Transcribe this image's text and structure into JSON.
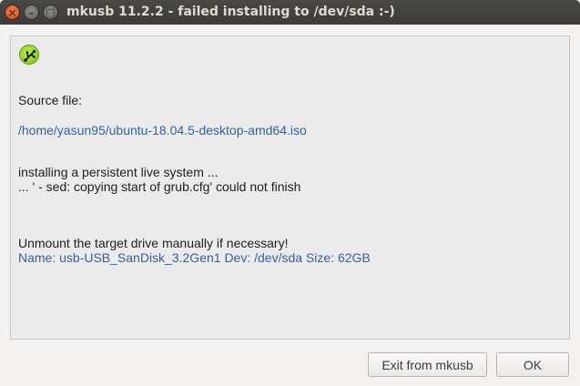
{
  "window": {
    "title": "mkusb 11.2.2 - failed installing to /dev/sda :-)",
    "close_glyph": "×",
    "minimize_glyph": "–",
    "maximize_glyph": "□"
  },
  "app_icon": "usb-icon",
  "message": {
    "source_label": "Source file:",
    "source_path": "/home/yasun95/ubuntu-18.04.5-desktop-amd64.iso",
    "status_line1": "installing a persistent live system ...",
    "status_line2": "... ' - sed: copying start of grub.cfg' could not finish",
    "unmount_note": "Unmount the target drive manually if necessary!",
    "drive_info": "Name: usb-USB_SanDisk_3.2Gen1 Dev: /dev/sda Size: 62GB"
  },
  "buttons": {
    "exit_label": "Exit from mkusb",
    "ok_label": "OK"
  },
  "colors": {
    "titlebar": "#3c3b37",
    "close_button": "#e0491c",
    "link_text": "#3260a6",
    "icon_green": "#8fd41e"
  }
}
